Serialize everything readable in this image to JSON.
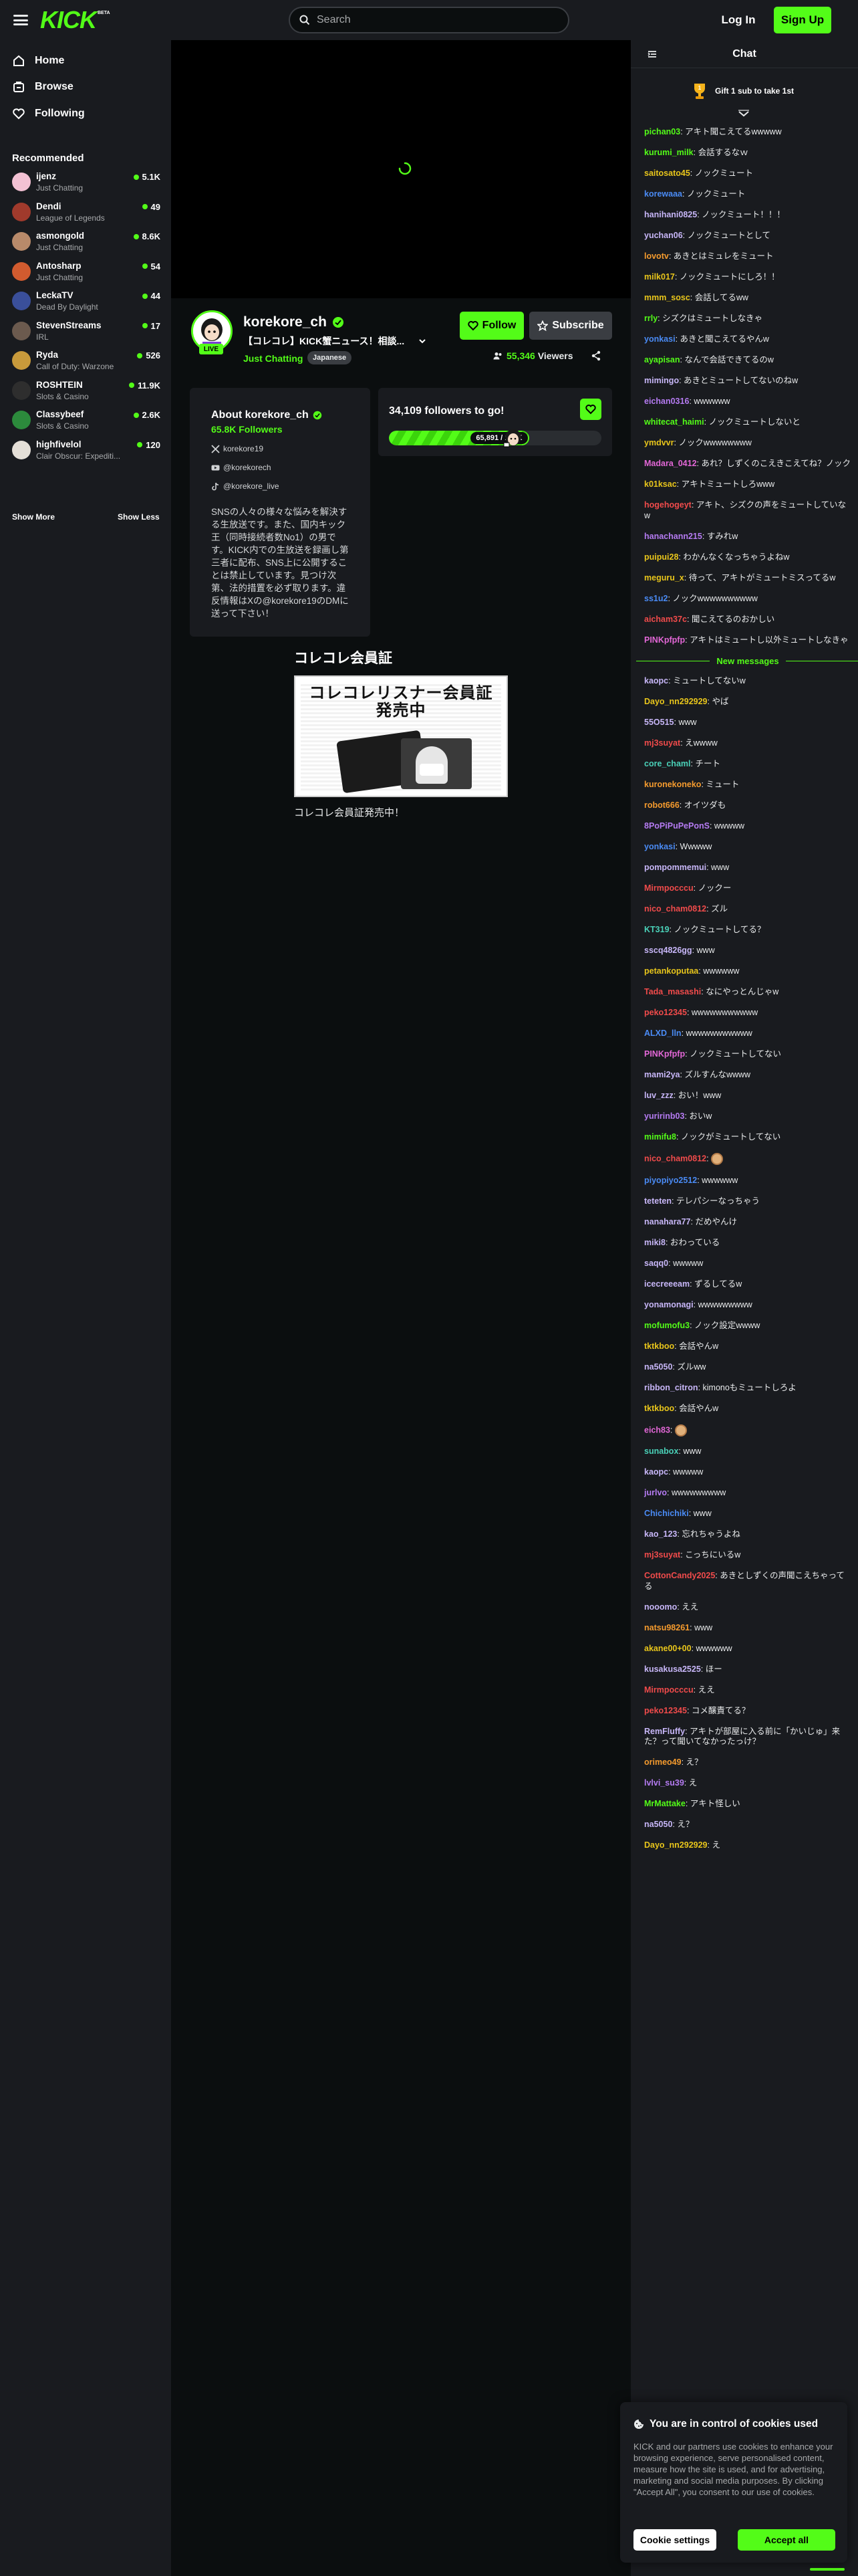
{
  "header": {
    "logo": "KICK",
    "logo_badge": "BETA",
    "search_placeholder": "Search",
    "login_label": "Log In",
    "signup_label": "Sign Up"
  },
  "sidebar": {
    "nav": [
      {
        "label": "Home",
        "icon": "home-icon"
      },
      {
        "label": "Browse",
        "icon": "browse-icon"
      },
      {
        "label": "Following",
        "icon": "heart-icon"
      }
    ],
    "recommended_title": "Recommended",
    "recommended": [
      {
        "name": "ijenz",
        "category": "Just Chatting",
        "viewers": "5.1K",
        "avatar_color": "#f3c1d3"
      },
      {
        "name": "Dendi",
        "category": "League of Legends",
        "viewers": "49",
        "avatar_color": "#a03a2c"
      },
      {
        "name": "asmongold",
        "category": "Just Chatting",
        "viewers": "8.6K",
        "avatar_color": "#b88a6a"
      },
      {
        "name": "Antosharp",
        "category": "Just Chatting",
        "viewers": "54",
        "avatar_color": "#d15b2f"
      },
      {
        "name": "LeckaTV",
        "category": "Dead By Daylight",
        "viewers": "44",
        "avatar_color": "#3a4f9a"
      },
      {
        "name": "StevenStreams",
        "category": "IRL",
        "viewers": "17",
        "avatar_color": "#6b5a4e"
      },
      {
        "name": "Ryda",
        "category": "Call of Duty: Warzone",
        "viewers": "526",
        "avatar_color": "#c89a3b"
      },
      {
        "name": "ROSHTEIN",
        "category": "Slots & Casino",
        "viewers": "11.9K",
        "avatar_color": "#2e2e2e"
      },
      {
        "name": "Classybeef",
        "category": "Slots & Casino",
        "viewers": "2.6K",
        "avatar_color": "#2c8a3c"
      },
      {
        "name": "highfivelol",
        "category": "Clair Obscur: Expediti...",
        "viewers": "120",
        "avatar_color": "#e4dfd7"
      }
    ],
    "show_more": "Show More",
    "show_less": "Show Less"
  },
  "channel": {
    "name": "korekore_ch",
    "live_badge": "LIVE",
    "stream_title": "【コレコレ】KICK蟹ニュース！相談...",
    "category": "Just Chatting",
    "tag": "Japanese",
    "follow_label": "Follow",
    "subscribe_label": "Subscribe",
    "viewers": "55,346",
    "viewers_label": "Viewers"
  },
  "about": {
    "title": "About korekore_ch",
    "followers": "65.8K Followers",
    "socials": [
      {
        "icon": "x-icon",
        "handle": "korekore19"
      },
      {
        "icon": "youtube-icon",
        "handle": "@korekorech"
      },
      {
        "icon": "tiktok-icon",
        "handle": "@korekore_live"
      }
    ],
    "description": "SNSの人々の様々な悩みを解決する生放送です。また、国内キック王（同時接続者数No1）の男です。KICK内での生放送を録画し第三者に配布、SNS上に公開することは禁止しています。見つけ次第、法的措置を必ず取ります。違反情報はXの@korekore19のDMに送って下さい！"
  },
  "goal": {
    "title": "34,109 followers to go!",
    "label": "65,891 / 100K",
    "progress": 0.659
  },
  "promo": {
    "section_title": "コレコレ会員証",
    "image_headline_1": "コレコレリスナー会員証",
    "image_headline_2": "発売中",
    "caption": "コレコレ会員証発売中！"
  },
  "chat": {
    "title": "Chat",
    "gift_text": "Gift 1 sub to take 1st",
    "new_messages_label": "New messages",
    "messages_before": [
      {
        "user": "pichan03",
        "color": "#53fc18",
        "text": "アキト聞こえてるwwwww"
      },
      {
        "user": "kurumi_milk",
        "color": "#53fc18",
        "text": "会話するなｗ"
      },
      {
        "user": "saitosato45",
        "color": "#e8c51b",
        "text": "ノックミュート"
      },
      {
        "user": "korewaaa",
        "color": "#4a8bf5",
        "text": "ノックミュート"
      },
      {
        "user": "hanihani0825",
        "color": "#c7b6f7",
        "text": "ノックミュート！！！"
      },
      {
        "user": "yuchan06",
        "color": "#c7b6f7",
        "text": "ノックミュートとして"
      },
      {
        "user": "lovotv",
        "color": "#f59b2e",
        "text": "あきとはミュレをミュート"
      },
      {
        "user": "milk017",
        "color": "#e8c51b",
        "text": "ノックミュートにしろ！！"
      },
      {
        "user": "mmm_sosc",
        "color": "#e8c51b",
        "text": "会話してるww"
      },
      {
        "user": "rrly",
        "color": "#53fc18",
        "text": "シズクはミュートしなきゃ"
      },
      {
        "user": "yonkasi",
        "color": "#4a8bf5",
        "text": "あきと聞こえてるやんw"
      },
      {
        "user": "ayapisan",
        "color": "#53fc18",
        "text": "なんで会話できてるのw"
      },
      {
        "user": "mimingo",
        "color": "#c7b6f7",
        "text": "あきとミュートしてないのねw"
      },
      {
        "user": "eichan0316",
        "color": "#b57bf2",
        "text": "wwwwww"
      },
      {
        "user": "whitecat_haimi",
        "color": "#53fc18",
        "text": "ノックミュートしないと"
      },
      {
        "user": "ymdvvr",
        "color": "#e8c51b",
        "text": "ノックwwwwwwww"
      },
      {
        "user": "Madara_0412",
        "color": "#e267d6",
        "text": "あれ？しずくのこえきこえてね？ノック"
      },
      {
        "user": "k01ksac",
        "color": "#e8c51b",
        "text": "アキトミュートしろwww"
      },
      {
        "user": "hogehogeyt",
        "color": "#f04b4b",
        "text": "アキト、シズクの声をミュートしていなw"
      },
      {
        "user": "hanachann215",
        "color": "#b57bf2",
        "text": "すみれw"
      },
      {
        "user": "puipui28",
        "color": "#e8c51b",
        "text": "わかんなくなっちゃうよねw"
      },
      {
        "user": "meguru_x",
        "color": "#e8c51b",
        "text": "待って、アキトがミュートミスってるw"
      },
      {
        "user": "ss1u2",
        "color": "#4a8bf5",
        "text": "ノックwwwwwwwwww"
      },
      {
        "user": "aicham37c",
        "color": "#f04b4b",
        "text": "聞こえてるのおかしい"
      },
      {
        "user": "PINKpfpfp",
        "color": "#e267d6",
        "text": "アキトはミュートし以外ミュートしなきゃ"
      }
    ],
    "messages_after": [
      {
        "user": "kaopc",
        "color": "#c7b6f7",
        "text": "ミュートしてないw"
      },
      {
        "user": "Dayo_nn292929",
        "color": "#e8c51b",
        "text": "やば"
      },
      {
        "user": "55O515",
        "color": "#c7b6f7",
        "text": "www"
      },
      {
        "user": "mj3suyat",
        "color": "#f04b4b",
        "text": "えwwww"
      },
      {
        "user": "core_chaml",
        "color": "#4ad1b8",
        "text": "チート"
      },
      {
        "user": "kuronekoneko",
        "color": "#f59b2e",
        "text": "ミュート"
      },
      {
        "user": "robot666",
        "color": "#f59b2e",
        "text": "オイツダも"
      },
      {
        "user": "8PoPiPuPePonS",
        "color": "#b57bf2",
        "text": "wwwww"
      },
      {
        "user": "yonkasi",
        "color": "#4a8bf5",
        "text": "Wwwww"
      },
      {
        "user": "pompommemui",
        "color": "#c7b6f7",
        "text": "www"
      },
      {
        "user": "Mirmpocccu",
        "color": "#f04b4b",
        "text": "ノックー"
      },
      {
        "user": "nico_cham0812",
        "color": "#f04b4b",
        "text": "ズル"
      },
      {
        "user": "KT319",
        "color": "#4ad1b8",
        "text": "ノックミュートしてる？"
      },
      {
        "user": "sscq4826gg",
        "color": "#c7b6f7",
        "text": "www"
      },
      {
        "user": "petankoputaa",
        "color": "#e8c51b",
        "text": "wwwwww"
      },
      {
        "user": "Tada_masashi",
        "color": "#f04b4b",
        "text": "なにやっとんじゃw"
      },
      {
        "user": "peko12345",
        "color": "#f04b4b",
        "text": "wwwwwwwwwww"
      },
      {
        "user": "ALXD_lln",
        "color": "#4a8bf5",
        "text": "wwwwwwwwwww"
      },
      {
        "user": "PINKpfpfp",
        "color": "#e267d6",
        "text": "ノックミュートしてない"
      },
      {
        "user": "mami2ya",
        "color": "#c7b6f7",
        "text": "ズルすんなwwww"
      },
      {
        "user": "luv_zzz",
        "color": "#c7b6f7",
        "text": "おい！www"
      },
      {
        "user": "yuririnb03",
        "color": "#b57bf2",
        "text": "おいw"
      },
      {
        "user": "mimifu8",
        "color": "#53fc18",
        "text": "ノックがミュートしてない"
      },
      {
        "user": "nico_cham0812",
        "color": "#f04b4b",
        "text": "",
        "emote": true
      },
      {
        "user": "piyopiyo2512",
        "color": "#4a8bf5",
        "text": "wwwwww"
      },
      {
        "user": "teteten",
        "color": "#c7b6f7",
        "text": "テレパシーなっちゃう"
      },
      {
        "user": "nanahara77",
        "color": "#c7b6f7",
        "text": "だめやんけ"
      },
      {
        "user": "miki8",
        "color": "#c7b6f7",
        "text": "おわっている"
      },
      {
        "user": "saqq0",
        "color": "#c7b6f7",
        "text": "wwwww"
      },
      {
        "user": "icecreeeam",
        "color": "#c7b6f7",
        "text": "ずるしてるw"
      },
      {
        "user": "yonamonagi",
        "color": "#c7b6f7",
        "text": "wwwwwwwww"
      },
      {
        "user": "mofumofu3",
        "color": "#53fc18",
        "text": "ノック設定wwww"
      },
      {
        "user": "tktkboo",
        "color": "#e8c51b",
        "text": "会話やんw"
      },
      {
        "user": "na5050",
        "color": "#c7b6f7",
        "text": "ズルww"
      },
      {
        "user": "ribbon_citron",
        "color": "#c7b6f7",
        "text": "kimonoもミュートしろよ"
      },
      {
        "user": "tktkboo",
        "color": "#e8c51b",
        "text": "会話やんw"
      },
      {
        "user": "eich83",
        "color": "#e267d6",
        "text": "",
        "emote": true
      },
      {
        "user": "sunabox",
        "color": "#4ad1b8",
        "text": "www"
      },
      {
        "user": "kaopc",
        "color": "#c7b6f7",
        "text": "wwwww"
      },
      {
        "user": "jurlvo",
        "color": "#b57bf2",
        "text": "wwwwwwwww"
      },
      {
        "user": "Chichichiki",
        "color": "#4a8bf5",
        "text": "www"
      },
      {
        "user": "kao_123",
        "color": "#c7b6f7",
        "text": "忘れちゃうよね"
      },
      {
        "user": "mj3suyat",
        "color": "#f04b4b",
        "text": "こっちにいるw"
      },
      {
        "user": "CottonCandy2025",
        "color": "#f04b4b",
        "text": "あきとしずくの声聞こえちゃってる"
      },
      {
        "user": "nooomo",
        "color": "#c7b6f7",
        "text": "ええ"
      },
      {
        "user": "natsu98261",
        "color": "#f59b2e",
        "text": "www"
      },
      {
        "user": "akane00+00",
        "color": "#e8c51b",
        "text": "wwwwww"
      },
      {
        "user": "kusakusa2525",
        "color": "#c7b6f7",
        "text": "ほー"
      },
      {
        "user": "Mirmpocccu",
        "color": "#f04b4b",
        "text": "ええ"
      },
      {
        "user": "peko12345",
        "color": "#f04b4b",
        "text": "コメ醸責てる？"
      },
      {
        "user": "RemFluffy",
        "color": "#c7b6f7",
        "text": "アキトが部屋に入る前に「かいじゅ」来た？って聞いてなかったっけ？"
      },
      {
        "user": "orimeo49",
        "color": "#f59b2e",
        "text": "え？"
      },
      {
        "user": "lvlvi_su39",
        "color": "#b57bf2",
        "text": "え"
      },
      {
        "user": "MrMattake",
        "color": "#53fc18",
        "text": "アキト怪しい"
      },
      {
        "user": "na5050",
        "color": "#c7b6f7",
        "text": "え？"
      },
      {
        "user": "Dayo_nn292929",
        "color": "#e8c51b",
        "text": "え"
      }
    ]
  },
  "cookie": {
    "title": "You are in control of cookies used",
    "text": "KICK and our partners use cookies to enhance your browsing experience, serve personalised content, measure how the site is used, and for advertising, marketing and social media purposes. By clicking \"Accept All\", you consent to our use of cookies.",
    "settings_label": "Cookie settings",
    "accept_label": "Accept all"
  },
  "colors": {
    "brand": "#53fc18",
    "background": "#0b0e0f",
    "panel": "#191b1f"
  }
}
